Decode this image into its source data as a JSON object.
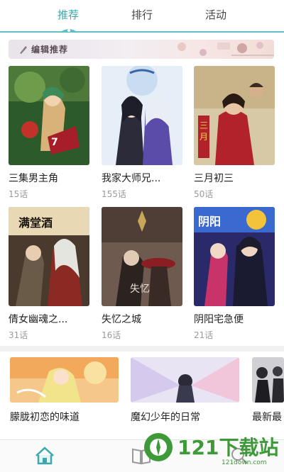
{
  "tabs": [
    {
      "label": "推荐",
      "active": true
    },
    {
      "label": "排行",
      "active": false
    },
    {
      "label": "活动",
      "active": false
    }
  ],
  "banner": {
    "label": "编辑推荐"
  },
  "grid": [
    {
      "title": "三集男主角",
      "count": "15话"
    },
    {
      "title": "我家大师兄...",
      "count": "155话"
    },
    {
      "title": "三月初三",
      "count": "50话"
    },
    {
      "title": "倩女幽魂之...",
      "count": "31话"
    },
    {
      "title": "失忆之城",
      "count": "16话"
    },
    {
      "title": "阴阳宅急便",
      "count": "21话"
    }
  ],
  "horizontal": [
    {
      "title": "朦胧初恋的味道"
    },
    {
      "title": "魔幻少年的日常"
    },
    {
      "title": "最新最"
    }
  ],
  "bottom_nav": [
    {
      "icon": "home-icon",
      "active": true
    },
    {
      "icon": "book-icon",
      "active": false
    },
    {
      "icon": "search-icon",
      "active": false
    }
  ],
  "watermark": {
    "text": "121下载站",
    "url": "121down.com"
  },
  "colors": {
    "accent": "#3aa9ad",
    "tab_line": "#5fbfc4"
  }
}
